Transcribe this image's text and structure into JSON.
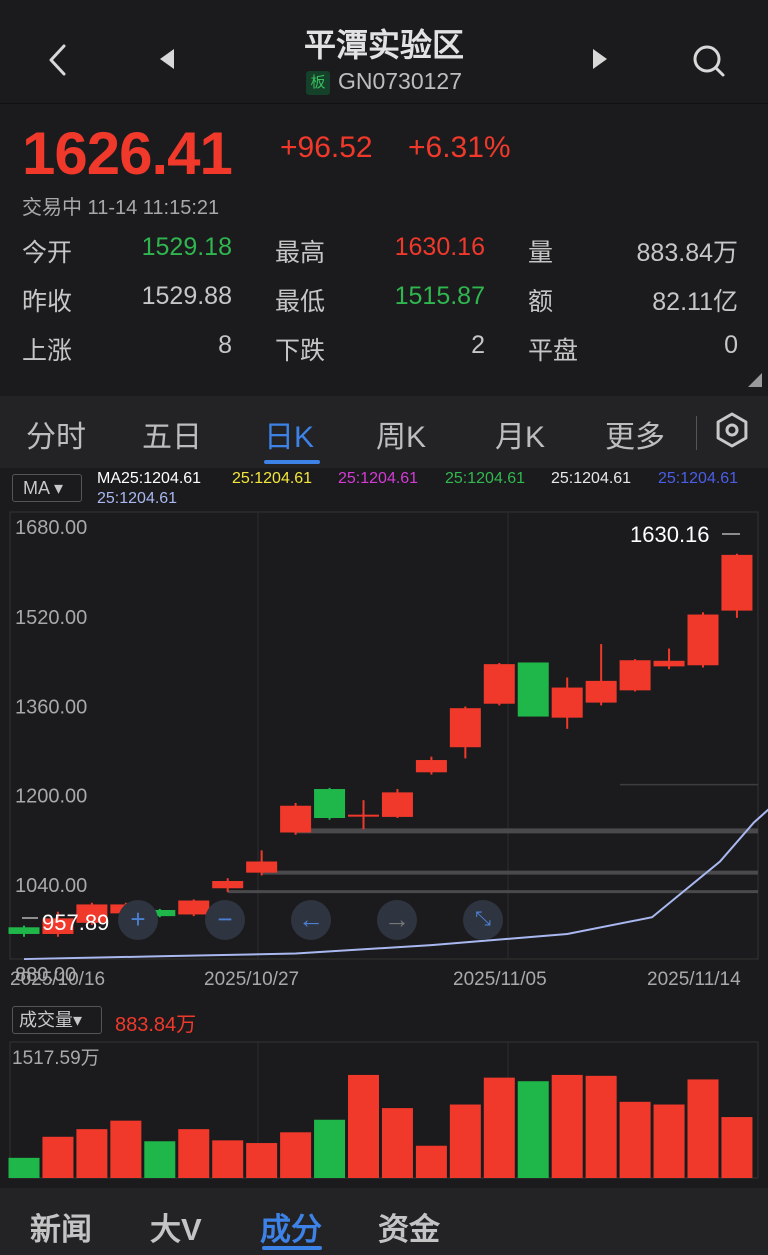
{
  "header": {
    "title": "平潭实验区",
    "board_tag": "板",
    "code": "GN0730127"
  },
  "quote": {
    "price": "1626.41",
    "change": "+96.52",
    "change_pct": "+6.31%",
    "status": "交易中 11-14 11:15:21",
    "rows": [
      [
        {
          "label": "今开",
          "value": "1529.18",
          "color": "green"
        },
        {
          "label": "最高",
          "value": "1630.16",
          "color": "red"
        },
        {
          "label": "量",
          "value": "883.84万",
          "color": "gray"
        }
      ],
      [
        {
          "label": "昨收",
          "value": "1529.88",
          "color": "gray"
        },
        {
          "label": "最低",
          "value": "1515.87",
          "color": "green"
        },
        {
          "label": "额",
          "value": "82.11亿",
          "color": "gray"
        }
      ],
      [
        {
          "label": "上涨",
          "value": "8",
          "color": "gray"
        },
        {
          "label": "下跌",
          "value": "2",
          "color": "gray"
        },
        {
          "label": "平盘",
          "value": "0",
          "color": "gray"
        }
      ]
    ]
  },
  "tabs": {
    "items": [
      "分时",
      "五日",
      "日K",
      "周K",
      "月K",
      "更多"
    ],
    "active": "日K"
  },
  "chart": {
    "ma_button": "MA",
    "ma_line1": [
      {
        "text": "MA25:1204.61",
        "color": "#ffffff"
      },
      {
        "text": "25:1204.61",
        "color": "#f2e63a"
      },
      {
        "text": "25:1204.61",
        "color": "#d43bd6"
      },
      {
        "text": "25:1204.61",
        "color": "#31b84f"
      },
      {
        "text": "25:1204.61",
        "color": "#e8e8e8"
      },
      {
        "text": "25:1204.61",
        "color": "#4a5ee8"
      }
    ],
    "ma_line2": {
      "text": "25:1204.61",
      "color": "#a9b8f0"
    },
    "y_ticks": [
      "1680.00",
      "1520.00",
      "1360.00",
      "1200.00",
      "1040.00",
      "880.00"
    ],
    "x_ticks": [
      "2025/10/16",
      "2025/10/27",
      "2025/11/05",
      "2025/11/14"
    ],
    "high_label": "1630.16",
    "low_label": "957.89",
    "vol_button": "成交量",
    "vol_value": "883.84万",
    "vol_max_label": "1517.59万"
  },
  "chart_data": {
    "type": "candlestick",
    "y_range": [
      880,
      1680
    ],
    "candles": [
      {
        "o": 950,
        "c": 962,
        "h": 965,
        "l": 945,
        "up": false
      },
      {
        "o": 950,
        "c": 978,
        "h": 990,
        "l": 945,
        "up": true
      },
      {
        "o": 970,
        "c": 1003,
        "h": 1006,
        "l": 966,
        "up": true
      },
      {
        "o": 987,
        "c": 1003,
        "h": 1006,
        "l": 980,
        "up": true
      },
      {
        "o": 993,
        "c": 982,
        "h": 995,
        "l": 980,
        "up": false
      },
      {
        "o": 985,
        "c": 1010,
        "h": 1012,
        "l": 982,
        "up": true
      },
      {
        "o": 1032,
        "c": 1045,
        "h": 1050,
        "l": 1025,
        "up": true
      },
      {
        "o": 1060,
        "c": 1080,
        "h": 1100,
        "l": 1055,
        "up": true
      },
      {
        "o": 1132,
        "c": 1180,
        "h": 1185,
        "l": 1128,
        "up": true
      },
      {
        "o": 1210,
        "c": 1158,
        "h": 1212,
        "l": 1155,
        "up": false
      },
      {
        "o": 1162,
        "c": 1164,
        "h": 1190,
        "l": 1138,
        "up": true
      },
      {
        "o": 1160,
        "c": 1204,
        "h": 1210,
        "l": 1158,
        "up": true
      },
      {
        "o": 1240,
        "c": 1262,
        "h": 1268,
        "l": 1236,
        "up": true
      },
      {
        "o": 1285,
        "c": 1355,
        "h": 1358,
        "l": 1265,
        "up": true
      },
      {
        "o": 1363,
        "c": 1434,
        "h": 1436,
        "l": 1360,
        "up": true
      },
      {
        "o": 1437,
        "c": 1340,
        "h": 1437,
        "l": 1340,
        "up": false
      },
      {
        "o": 1338,
        "c": 1392,
        "h": 1410,
        "l": 1318,
        "up": true
      },
      {
        "o": 1365,
        "c": 1404,
        "h": 1470,
        "l": 1360,
        "up": true
      },
      {
        "o": 1387,
        "c": 1441,
        "h": 1443,
        "l": 1385,
        "up": true
      },
      {
        "o": 1430,
        "c": 1440,
        "h": 1462,
        "l": 1425,
        "up": true
      },
      {
        "o": 1432,
        "c": 1523,
        "h": 1527,
        "l": 1428,
        "up": true
      },
      {
        "o": 1530,
        "c": 1630,
        "h": 1632,
        "l": 1517,
        "up": true
      }
    ],
    "ma_line_points": [
      [
        905,
        0
      ],
      [
        910,
        4
      ],
      [
        915,
        8
      ],
      [
        930,
        12
      ],
      [
        950,
        16
      ],
      [
        980,
        18.5
      ],
      [
        1030,
        19.5
      ],
      [
        1080,
        20.5
      ],
      [
        1150,
        21.5
      ],
      [
        1210,
        22.6
      ]
    ],
    "volume_range": [
      0,
      1517.59
    ],
    "volumes": [
      {
        "v": 225,
        "up": false
      },
      {
        "v": 460,
        "up": true
      },
      {
        "v": 545,
        "up": true
      },
      {
        "v": 640,
        "up": true
      },
      {
        "v": 410,
        "up": false
      },
      {
        "v": 545,
        "up": true
      },
      {
        "v": 420,
        "up": true
      },
      {
        "v": 390,
        "up": true
      },
      {
        "v": 510,
        "up": true
      },
      {
        "v": 650,
        "up": false
      },
      {
        "v": 1150,
        "up": true
      },
      {
        "v": 780,
        "up": true
      },
      {
        "v": 360,
        "up": true
      },
      {
        "v": 820,
        "up": true
      },
      {
        "v": 1120,
        "up": true
      },
      {
        "v": 1080,
        "up": false
      },
      {
        "v": 1150,
        "up": true
      },
      {
        "v": 1140,
        "up": true
      },
      {
        "v": 850,
        "up": true
      },
      {
        "v": 820,
        "up": true
      },
      {
        "v": 1100,
        "up": true
      },
      {
        "v": 680,
        "up": true
      }
    ]
  },
  "bottom_tabs": {
    "items": [
      "新闻",
      "大V",
      "成分",
      "资金"
    ],
    "active": "成分"
  }
}
